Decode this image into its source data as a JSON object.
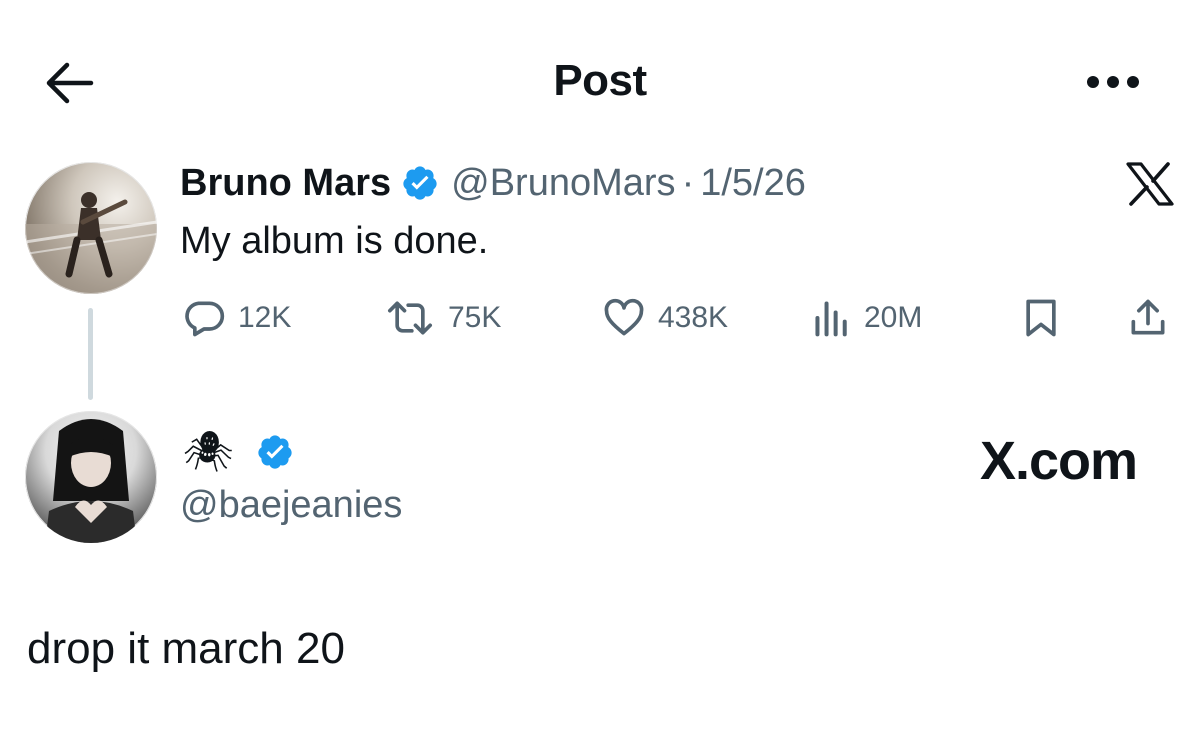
{
  "header": {
    "title": "Post",
    "back_icon": "arrow-left-icon",
    "more_icon": "more-horizontal-icon"
  },
  "tweet": {
    "display_name": "Bruno Mars",
    "handle": "@BrunoMars",
    "separator": "·",
    "date": "1/5/26",
    "text": "My album is done.",
    "verified_icon": "verified-badge-icon",
    "platform_icon": "x-logo-icon",
    "actions": {
      "replies": "12K",
      "reposts": "75K",
      "likes": "438K",
      "views": "20M"
    }
  },
  "reply": {
    "display_name": "🕷",
    "handle": "@baejeanies",
    "text": "drop it march 20",
    "watermark": "X.com"
  },
  "colors": {
    "text": "#0f1419",
    "secondary": "#536471",
    "verified_blue": "#1d9bf0",
    "thread_line": "#cfd9de"
  }
}
